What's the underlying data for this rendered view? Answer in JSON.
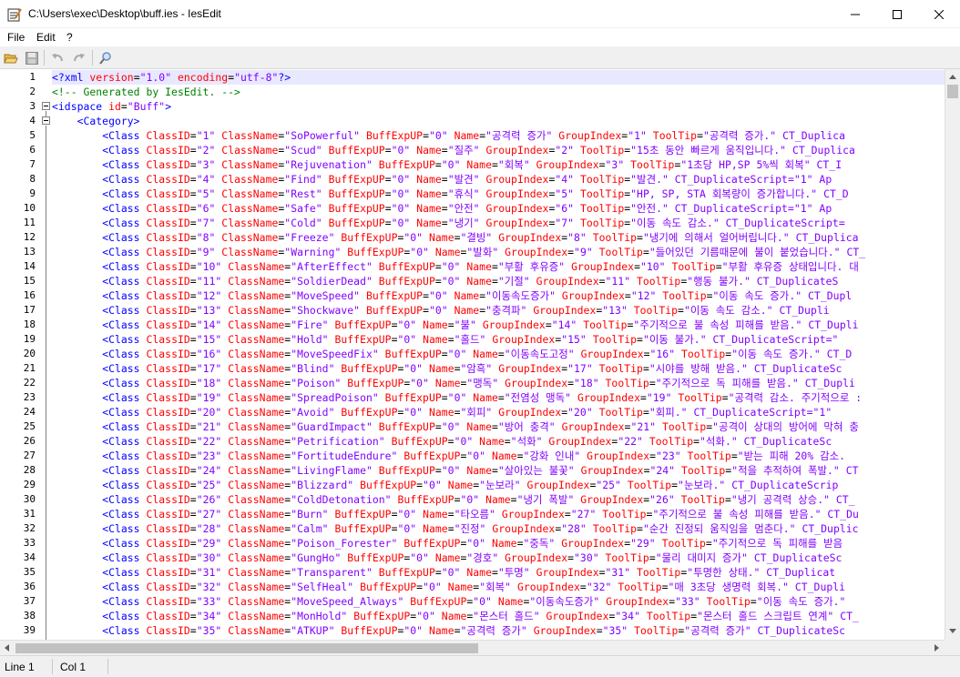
{
  "window": {
    "title": "C:\\Users\\exec\\Desktop\\buff.ies - IesEdit"
  },
  "menu": {
    "items": [
      {
        "label": "File"
      },
      {
        "label": "Edit"
      },
      {
        "label": "?"
      }
    ]
  },
  "toolbar": {
    "buttons": [
      {
        "icon": "open-folder-icon"
      },
      {
        "icon": "save-disk-icon"
      },
      {
        "icon": "undo-icon"
      },
      {
        "icon": "redo-icon"
      },
      {
        "icon": "find-icon"
      }
    ]
  },
  "editor": {
    "line_numbers": [
      "1",
      "2",
      "3",
      "4",
      "5",
      "6",
      "7",
      "8",
      "9",
      "10",
      "11",
      "12",
      "13",
      "14",
      "15",
      "16",
      "17",
      "18",
      "19",
      "20",
      "21",
      "22",
      "23",
      "24",
      "25",
      "26",
      "27",
      "28",
      "29",
      "30",
      "31",
      "32",
      "33",
      "34",
      "35",
      "36",
      "37",
      "38",
      "39"
    ],
    "lines": [
      {
        "indent": "",
        "kind": "pi",
        "text": "<?xml version=\"1.0\" encoding=\"utf-8\"?>"
      },
      {
        "indent": "",
        "kind": "comment",
        "text": "<!-- Generated by IesEdit. -->"
      },
      {
        "indent": "",
        "kind": "idspace",
        "text": "<idspace id=\"Buff\">"
      },
      {
        "indent": "    ",
        "kind": "category",
        "text": "<Category>"
      },
      {
        "indent": "        ",
        "kind": "class",
        "id": "1",
        "name": "SoPowerful",
        "exp": "0",
        "kname": "공격력 증가",
        "group": "1",
        "tip": "공격력 증가.\" CT_Duplica"
      },
      {
        "indent": "        ",
        "kind": "class",
        "id": "2",
        "name": "Scud",
        "exp": "0",
        "kname": "질주",
        "group": "2",
        "tip": "15초 동안 빠르게 움직입니다.\" CT_Duplica"
      },
      {
        "indent": "        ",
        "kind": "class",
        "id": "3",
        "name": "Rejuvenation",
        "exp": "0",
        "kname": "회복",
        "group": "3",
        "tip": "1초당 HP,SP 5%씩 회복\" CT_I"
      },
      {
        "indent": "        ",
        "kind": "class",
        "id": "4",
        "name": "Find",
        "exp": "0",
        "kname": "발견",
        "group": "4",
        "tip": "발견.\" CT_DuplicateScript=\"1\" Ap"
      },
      {
        "indent": "        ",
        "kind": "class",
        "id": "5",
        "name": "Rest",
        "exp": "0",
        "kname": "휴식",
        "group": "5",
        "tip": "HP, SP, STA 회복량이 증가합니다.\" CT_D"
      },
      {
        "indent": "        ",
        "kind": "class",
        "id": "6",
        "name": "Safe",
        "exp": "0",
        "kname": "안전",
        "group": "6",
        "tip": "안전.\" CT_DuplicateScript=\"1\" Ap"
      },
      {
        "indent": "        ",
        "kind": "class",
        "id": "7",
        "name": "Cold",
        "exp": "0",
        "kname": "냉기",
        "group": "7",
        "tip": "이동 속도 감소.\" CT_DuplicateScript="
      },
      {
        "indent": "        ",
        "kind": "class",
        "id": "8",
        "name": "Freeze",
        "exp": "0",
        "kname": "결빙",
        "group": "8",
        "tip": "냉기에 의해서 얼어버립니다.\" CT_Duplica"
      },
      {
        "indent": "        ",
        "kind": "class",
        "id": "9",
        "name": "Warning",
        "exp": "0",
        "kname": "발화",
        "group": "9",
        "tip": "들어있던 기름때문에 불이 붙었습니다.\" CT_"
      },
      {
        "indent": "        ",
        "kind": "class",
        "id": "10",
        "name": "AfterEffect",
        "exp": "0",
        "kname": "부활 후유증",
        "group": "10",
        "tip": "부활 후유증 상태입니다. 대"
      },
      {
        "indent": "        ",
        "kind": "class",
        "id": "11",
        "name": "SoldierDead",
        "exp": "0",
        "kname": "기절",
        "group": "11",
        "tip": "행동 불가.\" CT_DuplicateS"
      },
      {
        "indent": "        ",
        "kind": "class",
        "id": "12",
        "name": "MoveSpeed",
        "exp": "0",
        "kname": "이동속도증가",
        "group": "12",
        "tip": "이동 속도 증가.\" CT_Dupl"
      },
      {
        "indent": "        ",
        "kind": "class",
        "id": "13",
        "name": "Shockwave",
        "exp": "0",
        "kname": "충격파",
        "group": "13",
        "tip": "이동 속도 감소.\" CT_Dupli"
      },
      {
        "indent": "        ",
        "kind": "class",
        "id": "14",
        "name": "Fire",
        "exp": "0",
        "kname": "불",
        "group": "14",
        "tip": "주기적으로 불 속성 피해를 받음.\" CT_Dupli"
      },
      {
        "indent": "        ",
        "kind": "class",
        "id": "15",
        "name": "Hold",
        "exp": "0",
        "kname": "홀드",
        "group": "15",
        "tip": "이동 불가.\" CT_DuplicateScript=\""
      },
      {
        "indent": "        ",
        "kind": "class",
        "id": "16",
        "name": "MoveSpeedFix",
        "exp": "0",
        "kname": "이동속도고정",
        "group": "16",
        "tip": "이동 속도 증가.\" CT_D"
      },
      {
        "indent": "        ",
        "kind": "class",
        "id": "17",
        "name": "Blind",
        "exp": "0",
        "kname": "암흑",
        "group": "17",
        "tip": "시야를 방해 받음.\" CT_DuplicateSc"
      },
      {
        "indent": "        ",
        "kind": "class",
        "id": "18",
        "name": "Poison",
        "exp": "0",
        "kname": "맹독",
        "group": "18",
        "tip": "주기적으로 독 피해를 받음.\" CT_Dupli"
      },
      {
        "indent": "        ",
        "kind": "class",
        "id": "19",
        "name": "SpreadPoison",
        "exp": "0",
        "kname": "전염성 맹독",
        "group": "19",
        "tip": "공격력 감소. 주기적으로 :"
      },
      {
        "indent": "        ",
        "kind": "class",
        "id": "20",
        "name": "Avoid",
        "exp": "0",
        "kname": "회피",
        "group": "20",
        "tip": "회피.\" CT_DuplicateScript=\"1\""
      },
      {
        "indent": "        ",
        "kind": "class",
        "id": "21",
        "name": "GuardImpact",
        "exp": "0",
        "kname": "방어 충격",
        "group": "21",
        "tip": "공격이 상대의 방어에 막혀 충"
      },
      {
        "indent": "        ",
        "kind": "class",
        "id": "22",
        "name": "Petrification",
        "exp": "0",
        "kname": "석화",
        "group": "22",
        "tip": "석화.\" CT_DuplicateSc"
      },
      {
        "indent": "        ",
        "kind": "class",
        "id": "23",
        "name": "FortitudeEndure",
        "exp": "0",
        "kname": "강화 인내",
        "group": "23",
        "tip": "받는 피해 20% 감소."
      },
      {
        "indent": "        ",
        "kind": "class",
        "id": "24",
        "name": "LivingFlame",
        "exp": "0",
        "kname": "살아있는 불꽃",
        "group": "24",
        "tip": "적을 추적하여 폭발.\" CT"
      },
      {
        "indent": "        ",
        "kind": "class",
        "id": "25",
        "name": "Blizzard",
        "exp": "0",
        "kname": "눈보라",
        "group": "25",
        "tip": "눈보라.\" CT_DuplicateScrip"
      },
      {
        "indent": "        ",
        "kind": "class",
        "id": "26",
        "name": "ColdDetonation",
        "exp": "0",
        "kname": "냉기 폭발",
        "group": "26",
        "tip": "냉기 공격력 상승.\" CT_"
      },
      {
        "indent": "        ",
        "kind": "class",
        "id": "27",
        "name": "Burn",
        "exp": "0",
        "kname": "타오름",
        "group": "27",
        "tip": "주기적으로 불 속성 피해를 받음.\" CT_Du"
      },
      {
        "indent": "        ",
        "kind": "class",
        "id": "28",
        "name": "Calm",
        "exp": "0",
        "kname": "진정",
        "group": "28",
        "tip": "순간 진정되 움직임을 멈춘다.\" CT_Duplic"
      },
      {
        "indent": "        ",
        "kind": "class",
        "id": "29",
        "name": "Poison_Forester",
        "exp": "0",
        "kname": "중독",
        "group": "29",
        "tip": "주기적으로 독 피해를 받음"
      },
      {
        "indent": "        ",
        "kind": "class",
        "id": "30",
        "name": "GungHo",
        "exp": "0",
        "kname": "경호",
        "group": "30",
        "tip": "물리 대미지 증가\" CT_DuplicateSc"
      },
      {
        "indent": "        ",
        "kind": "class",
        "id": "31",
        "name": "Transparent",
        "exp": "0",
        "kname": "투명",
        "group": "31",
        "tip": "투명한 상태.\" CT_Duplicat"
      },
      {
        "indent": "        ",
        "kind": "class",
        "id": "32",
        "name": "SelfHeal",
        "exp": "0",
        "kname": "회복",
        "group": "32",
        "tip": "매 3초당 생명력 회복.\" CT_Dupli"
      },
      {
        "indent": "        ",
        "kind": "class",
        "id": "33",
        "name": "MoveSpeed_Always",
        "exp": "0",
        "kname": "이동속도증가",
        "group": "33",
        "tip": "이동 속도 증가.\""
      },
      {
        "indent": "        ",
        "kind": "class",
        "id": "34",
        "name": "MonHold",
        "exp": "0",
        "kname": "몬스터 홀드",
        "group": "34",
        "tip": "몬스터 홀드 스크립트 연계\" CT_"
      },
      {
        "indent": "        ",
        "kind": "class",
        "id": "35",
        "name": "ATKUP",
        "exp": "0",
        "kname": "공격력 증가",
        "group": "35",
        "tip": "공격력 증가\" CT_DuplicateSc"
      }
    ]
  },
  "status": {
    "line": "Line 1",
    "col": "Col 1"
  },
  "colors": {
    "tag": "#0000ff",
    "attribute": "#ff0000",
    "value": "#8000ff",
    "comment": "#008000",
    "current_line": "#e8e8ff"
  }
}
